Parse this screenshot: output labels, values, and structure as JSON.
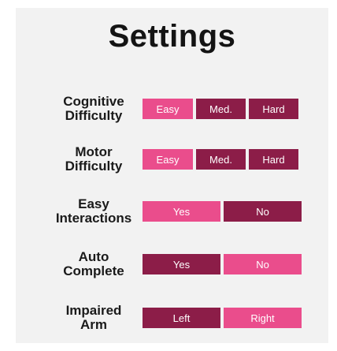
{
  "title": "Settings",
  "colors": {
    "selected": "#ea4d8c",
    "unselected": "#8c1d48"
  },
  "settings": [
    {
      "label": "Cognitive\nDifficulty",
      "options": [
        {
          "label": "Easy",
          "selected": true
        },
        {
          "label": "Med.",
          "selected": false
        },
        {
          "label": "Hard",
          "selected": false
        }
      ]
    },
    {
      "label": "Motor\nDifficulty",
      "options": [
        {
          "label": "Easy",
          "selected": true
        },
        {
          "label": "Med.",
          "selected": false
        },
        {
          "label": "Hard",
          "selected": false
        }
      ]
    },
    {
      "label": "Easy\nInteractions",
      "options": [
        {
          "label": "Yes",
          "selected": true
        },
        {
          "label": "No",
          "selected": false
        }
      ]
    },
    {
      "label": "Auto\nComplete",
      "options": [
        {
          "label": "Yes",
          "selected": false
        },
        {
          "label": "No",
          "selected": true
        }
      ]
    },
    {
      "label": "Impaired\nArm",
      "options": [
        {
          "label": "Left",
          "selected": false
        },
        {
          "label": "Right",
          "selected": true
        }
      ]
    }
  ]
}
